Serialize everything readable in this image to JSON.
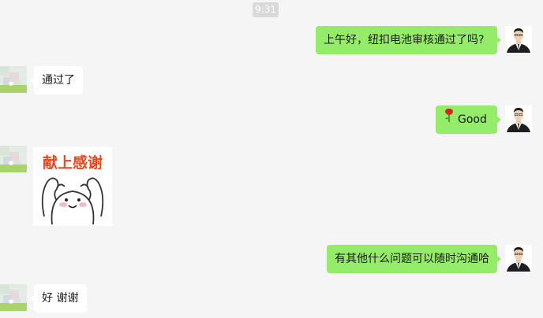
{
  "chat": {
    "timestamp": "9:31",
    "messages": [
      {
        "direction": "out",
        "text": "上午好，纽扣电池审核通过了吗?"
      },
      {
        "direction": "in",
        "text": "通过了"
      },
      {
        "direction": "out",
        "icon": "rose-icon",
        "text": "Good"
      },
      {
        "direction": "in",
        "type": "sticker",
        "text": "献上感谢"
      },
      {
        "direction": "out",
        "text": "有其他什么问题可以随时沟通哈"
      },
      {
        "direction": "in",
        "text": "好 谢谢"
      }
    ]
  },
  "colors": {
    "background": "#f5f5f5",
    "outgoing_bubble": "#95ec69",
    "incoming_bubble": "#ffffff",
    "sticker_text": "#e8481c"
  }
}
